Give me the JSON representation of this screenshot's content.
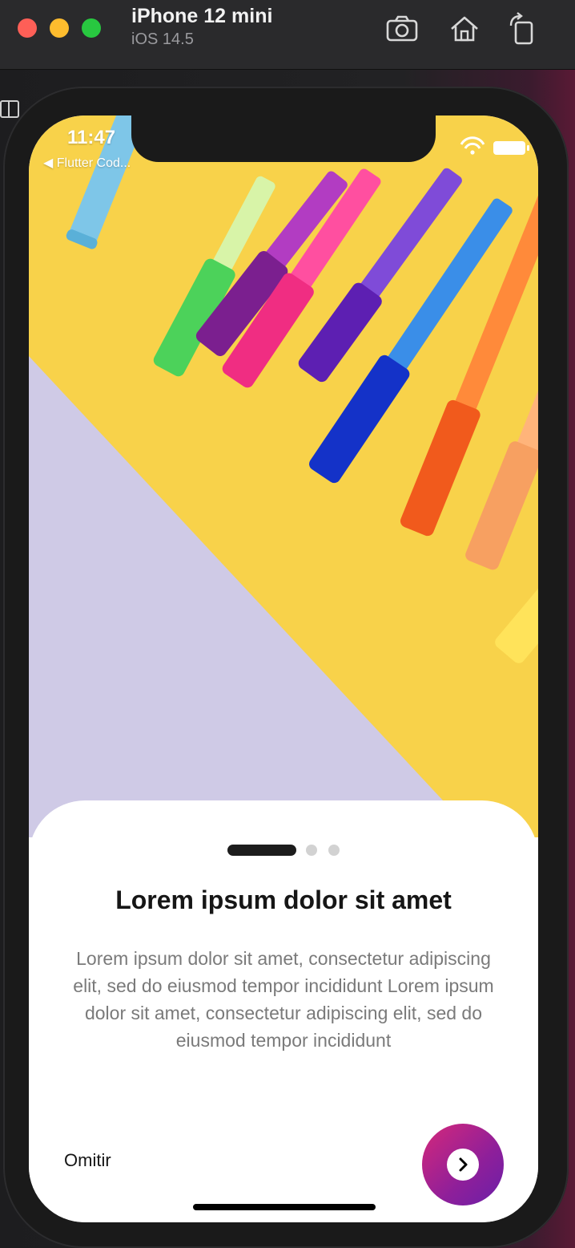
{
  "window": {
    "device_name": "iPhone 12 mini",
    "os_version": "iOS 14.5",
    "toolbar_icons": [
      "screenshot-icon",
      "home-icon",
      "rotate-icon"
    ]
  },
  "status_bar": {
    "time": "11:47",
    "back_label": "◀ Flutter Cod..."
  },
  "onboarding": {
    "page_indicator": {
      "total": 3,
      "active": 1
    },
    "title": "Lorem ipsum dolor sit amet",
    "description": "Lorem ipsum dolor sit amet, consectetur adipiscing elit, sed do eiusmod tempor incididunt Lorem ipsum dolor sit amet, consectetur adipiscing elit, sed do eiusmod tempor incididunt",
    "skip_label": "Omitir",
    "next_icon": "chevron-right-icon"
  },
  "colors": {
    "hero_yellow": "#f8d24a",
    "hero_lavender": "#cfcae6",
    "button_gradient_start": "#d6287a",
    "button_gradient_end": "#6a1fa8"
  }
}
